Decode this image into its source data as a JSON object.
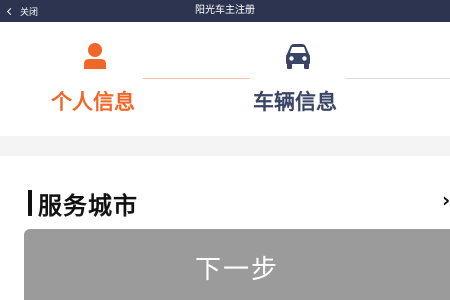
{
  "topbar": {
    "back_label": "关闭",
    "title": "阳光车主注册"
  },
  "steps": [
    {
      "label": "个人信息",
      "icon": "person-icon",
      "state": "active",
      "color": "#f0672a"
    },
    {
      "label": "车辆信息",
      "icon": "car-icon",
      "state": "inactive",
      "color": "#3a4566"
    }
  ],
  "section": {
    "title": "服务城市"
  },
  "footer": {
    "next_label": "下一步"
  },
  "colors": {
    "accent": "#f0672a",
    "navy": "#2d3450",
    "disabled": "#9b9b9b"
  }
}
